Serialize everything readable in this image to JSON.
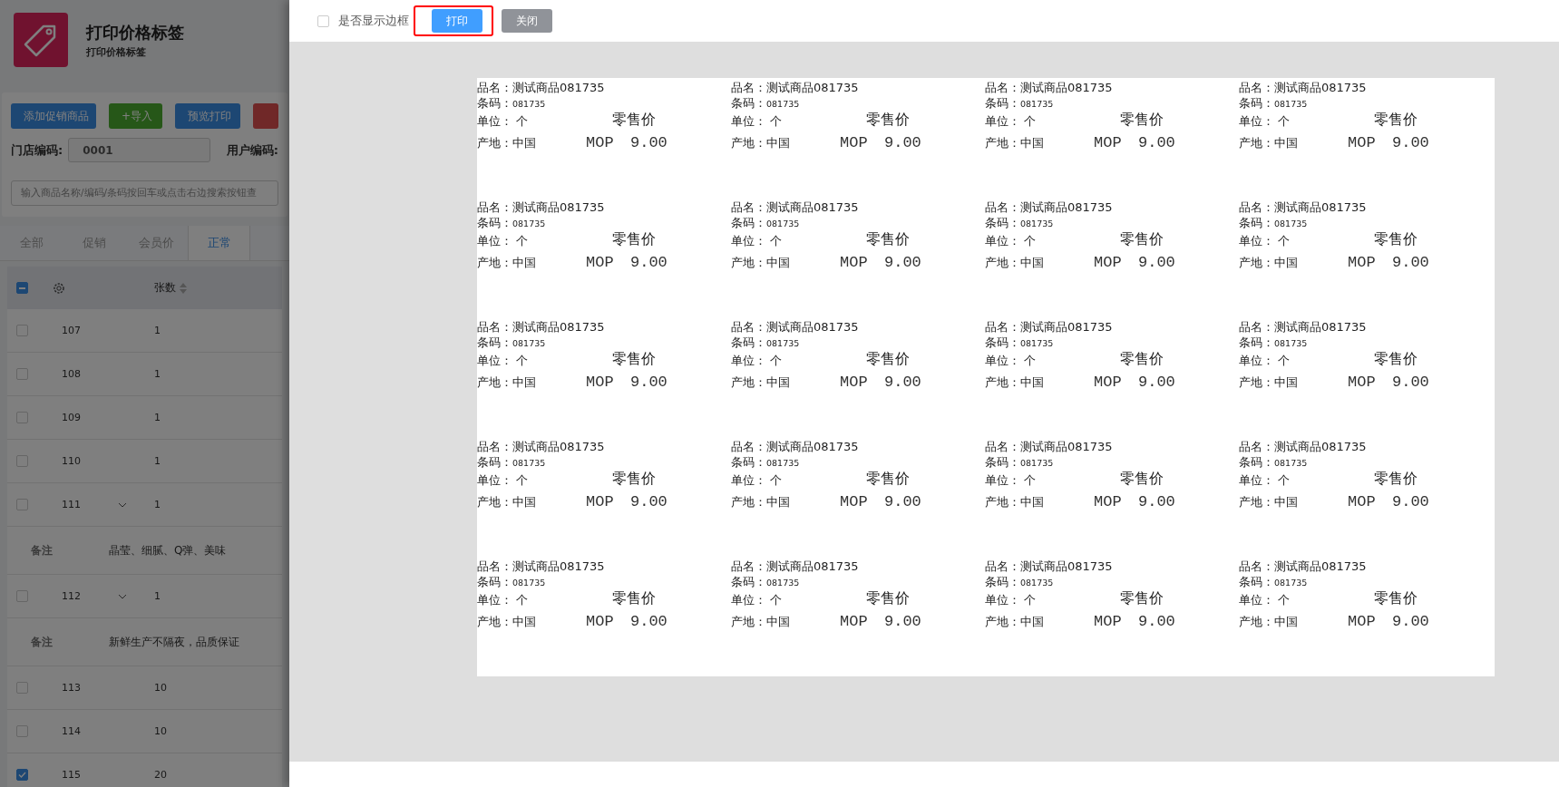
{
  "app": {
    "title": "打印价格标签",
    "subtitle": "打印价格标签",
    "buttons": [
      {
        "label": "添加促销商品",
        "kind": "primary"
      },
      {
        "label": "+导入",
        "kind": "success"
      },
      {
        "label": "预览打印",
        "kind": "primary"
      },
      {
        "kind": "danger"
      }
    ],
    "store_code": {
      "label": "门店编码:",
      "value": "0001"
    },
    "user_code": {
      "label": "用户编码:"
    },
    "search": {
      "placeholder": "输入商品名称/编码/条码按回车或点击右边搜索按钮查"
    },
    "tabs": [
      {
        "label": "全部",
        "selected": false
      },
      {
        "label": "促销",
        "selected": false
      },
      {
        "label": "会员价",
        "selected": false
      },
      {
        "label": "正常",
        "selected": true
      }
    ],
    "table": {
      "select_all_indeterminate": true,
      "qty_header": "张数",
      "rows": [
        {
          "kind": "item",
          "id": "107",
          "qty": "1",
          "checked": false,
          "expanded": false
        },
        {
          "kind": "item",
          "id": "108",
          "qty": "1",
          "checked": false,
          "expanded": false
        },
        {
          "kind": "item",
          "id": "109",
          "qty": "1",
          "checked": false,
          "expanded": false
        },
        {
          "kind": "item",
          "id": "110",
          "qty": "1",
          "checked": false,
          "expanded": false
        },
        {
          "kind": "item",
          "id": "111",
          "qty": "1",
          "checked": false,
          "expanded": true
        },
        {
          "kind": "remark",
          "label": "备注",
          "text": "晶莹、细腻、Q弹、美味"
        },
        {
          "kind": "item",
          "id": "112",
          "qty": "1",
          "checked": false,
          "expanded": true
        },
        {
          "kind": "remark",
          "label": "备注",
          "text": "新鲜生产不隔夜，品质保证"
        },
        {
          "kind": "item",
          "id": "113",
          "qty": "10",
          "checked": false,
          "expanded": false
        },
        {
          "kind": "item",
          "id": "114",
          "qty": "10",
          "checked": false,
          "expanded": false
        },
        {
          "kind": "item",
          "id": "115",
          "qty": "20",
          "checked": true,
          "expanded": false
        }
      ]
    }
  },
  "dialog": {
    "show_border": {
      "label": "是否显示边框",
      "checked": false
    },
    "print_button": "打印",
    "close_button": "关闭",
    "labels": [
      {
        "name_label": "品名：",
        "name": "测试商品081735",
        "barcode_label": "条码：",
        "barcode": "081735",
        "unit_label": "单位：",
        "unit": "个",
        "price_title": "零售价",
        "origin_label": "产地：",
        "origin": "中国",
        "currency": "MOP",
        "price": "9.00"
      },
      {
        "name_label": "品名：",
        "name": "测试商品081735",
        "barcode_label": "条码：",
        "barcode": "081735",
        "unit_label": "单位：",
        "unit": "个",
        "price_title": "零售价",
        "origin_label": "产地：",
        "origin": "中国",
        "currency": "MOP",
        "price": "9.00"
      },
      {
        "name_label": "品名：",
        "name": "测试商品081735",
        "barcode_label": "条码：",
        "barcode": "081735",
        "unit_label": "单位：",
        "unit": "个",
        "price_title": "零售价",
        "origin_label": "产地：",
        "origin": "中国",
        "currency": "MOP",
        "price": "9.00"
      },
      {
        "name_label": "品名：",
        "name": "测试商品081735",
        "barcode_label": "条码：",
        "barcode": "081735",
        "unit_label": "单位：",
        "unit": "个",
        "price_title": "零售价",
        "origin_label": "产地：",
        "origin": "中国",
        "currency": "MOP",
        "price": "9.00"
      },
      {
        "name_label": "品名：",
        "name": "测试商品081735",
        "barcode_label": "条码：",
        "barcode": "081735",
        "unit_label": "单位：",
        "unit": "个",
        "price_title": "零售价",
        "origin_label": "产地：",
        "origin": "中国",
        "currency": "MOP",
        "price": "9.00"
      },
      {
        "name_label": "品名：",
        "name": "测试商品081735",
        "barcode_label": "条码：",
        "barcode": "081735",
        "unit_label": "单位：",
        "unit": "个",
        "price_title": "零售价",
        "origin_label": "产地：",
        "origin": "中国",
        "currency": "MOP",
        "price": "9.00"
      },
      {
        "name_label": "品名：",
        "name": "测试商品081735",
        "barcode_label": "条码：",
        "barcode": "081735",
        "unit_label": "单位：",
        "unit": "个",
        "price_title": "零售价",
        "origin_label": "产地：",
        "origin": "中国",
        "currency": "MOP",
        "price": "9.00"
      },
      {
        "name_label": "品名：",
        "name": "测试商品081735",
        "barcode_label": "条码：",
        "barcode": "081735",
        "unit_label": "单位：",
        "unit": "个",
        "price_title": "零售价",
        "origin_label": "产地：",
        "origin": "中国",
        "currency": "MOP",
        "price": "9.00"
      },
      {
        "name_label": "品名：",
        "name": "测试商品081735",
        "barcode_label": "条码：",
        "barcode": "081735",
        "unit_label": "单位：",
        "unit": "个",
        "price_title": "零售价",
        "origin_label": "产地：",
        "origin": "中国",
        "currency": "MOP",
        "price": "9.00"
      },
      {
        "name_label": "品名：",
        "name": "测试商品081735",
        "barcode_label": "条码：",
        "barcode": "081735",
        "unit_label": "单位：",
        "unit": "个",
        "price_title": "零售价",
        "origin_label": "产地：",
        "origin": "中国",
        "currency": "MOP",
        "price": "9.00"
      },
      {
        "name_label": "品名：",
        "name": "测试商品081735",
        "barcode_label": "条码：",
        "barcode": "081735",
        "unit_label": "单位：",
        "unit": "个",
        "price_title": "零售价",
        "origin_label": "产地：",
        "origin": "中国",
        "currency": "MOP",
        "price": "9.00"
      },
      {
        "name_label": "品名：",
        "name": "测试商品081735",
        "barcode_label": "条码：",
        "barcode": "081735",
        "unit_label": "单位：",
        "unit": "个",
        "price_title": "零售价",
        "origin_label": "产地：",
        "origin": "中国",
        "currency": "MOP",
        "price": "9.00"
      },
      {
        "name_label": "品名：",
        "name": "测试商品081735",
        "barcode_label": "条码：",
        "barcode": "081735",
        "unit_label": "单位：",
        "unit": "个",
        "price_title": "零售价",
        "origin_label": "产地：",
        "origin": "中国",
        "currency": "MOP",
        "price": "9.00"
      },
      {
        "name_label": "品名：",
        "name": "测试商品081735",
        "barcode_label": "条码：",
        "barcode": "081735",
        "unit_label": "单位：",
        "unit": "个",
        "price_title": "零售价",
        "origin_label": "产地：",
        "origin": "中国",
        "currency": "MOP",
        "price": "9.00"
      },
      {
        "name_label": "品名：",
        "name": "测试商品081735",
        "barcode_label": "条码：",
        "barcode": "081735",
        "unit_label": "单位：",
        "unit": "个",
        "price_title": "零售价",
        "origin_label": "产地：",
        "origin": "中国",
        "currency": "MOP",
        "price": "9.00"
      },
      {
        "name_label": "品名：",
        "name": "测试商品081735",
        "barcode_label": "条码：",
        "barcode": "081735",
        "unit_label": "单位：",
        "unit": "个",
        "price_title": "零售价",
        "origin_label": "产地：",
        "origin": "中国",
        "currency": "MOP",
        "price": "9.00"
      },
      {
        "name_label": "品名：",
        "name": "测试商品081735",
        "barcode_label": "条码：",
        "barcode": "081735",
        "unit_label": "单位：",
        "unit": "个",
        "price_title": "零售价",
        "origin_label": "产地：",
        "origin": "中国",
        "currency": "MOP",
        "price": "9.00"
      },
      {
        "name_label": "品名：",
        "name": "测试商品081735",
        "barcode_label": "条码：",
        "barcode": "081735",
        "unit_label": "单位：",
        "unit": "个",
        "price_title": "零售价",
        "origin_label": "产地：",
        "origin": "中国",
        "currency": "MOP",
        "price": "9.00"
      },
      {
        "name_label": "品名：",
        "name": "测试商品081735",
        "barcode_label": "条码：",
        "barcode": "081735",
        "unit_label": "单位：",
        "unit": "个",
        "price_title": "零售价",
        "origin_label": "产地：",
        "origin": "中国",
        "currency": "MOP",
        "price": "9.00"
      },
      {
        "name_label": "品名：",
        "name": "测试商品081735",
        "barcode_label": "条码：",
        "barcode": "081735",
        "unit_label": "单位：",
        "unit": "个",
        "price_title": "零售价",
        "origin_label": "产地：",
        "origin": "中国",
        "currency": "MOP",
        "price": "9.00"
      }
    ]
  }
}
